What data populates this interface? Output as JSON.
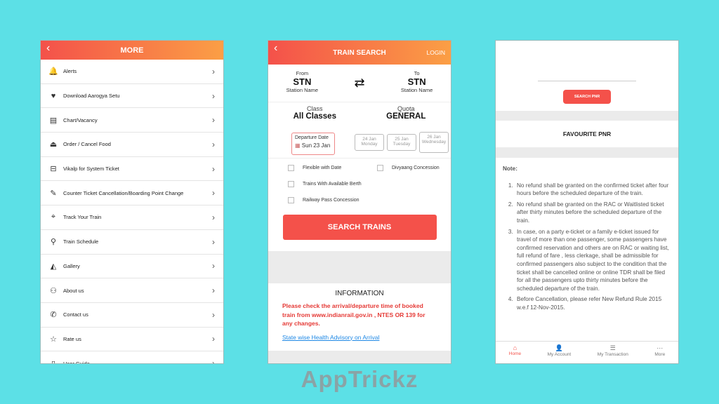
{
  "more": {
    "title": "MORE",
    "items": [
      {
        "label": "Alerts",
        "icon": "bell-icon",
        "glyph": "🔔"
      },
      {
        "label": "Download Aarogya Setu",
        "icon": "heart-icon",
        "glyph": "♥"
      },
      {
        "label": "Chart/Vacancy",
        "icon": "chart-icon",
        "glyph": "▤"
      },
      {
        "label": "Order / Cancel Food",
        "icon": "food-cloche-icon",
        "glyph": "⏏"
      },
      {
        "label": "Vikalp for System Ticket",
        "icon": "train-icon",
        "glyph": "⊟"
      },
      {
        "label": "Counter Ticket Cancellation/Boarding Point Change",
        "icon": "document-edit-icon",
        "glyph": "✎"
      },
      {
        "label": "Track Your Train",
        "icon": "location-pin-icon",
        "glyph": "⌖"
      },
      {
        "label": "Train Schedule",
        "icon": "schedule-icon",
        "glyph": "⚲"
      },
      {
        "label": "Gallery",
        "icon": "gallery-icon",
        "glyph": "◭"
      },
      {
        "label": "About us",
        "icon": "users-icon",
        "glyph": "⚇"
      },
      {
        "label": "Contact us",
        "icon": "phone-icon",
        "glyph": "✆"
      },
      {
        "label": "Rate us",
        "icon": "star-icon",
        "glyph": "☆"
      },
      {
        "label": "User Guide",
        "icon": "guide-icon",
        "glyph": "▯"
      }
    ]
  },
  "search": {
    "title": "TRAIN SEARCH",
    "login": "LOGIN",
    "from": {
      "label": "From",
      "code": "STN",
      "name": "Station Name"
    },
    "to": {
      "label": "To",
      "code": "STN",
      "name": "Station Name"
    },
    "class": {
      "label": "Class",
      "value": "All Classes"
    },
    "quota": {
      "label": "Quota",
      "value": "GENERAL"
    },
    "departure": {
      "label": "Departure Date",
      "value": "Sun 23 Jan"
    },
    "dates": [
      {
        "date": "24 Jan",
        "day": "Monday"
      },
      {
        "date": "25 Jan",
        "day": "Tuesday"
      },
      {
        "date": "26 Jan",
        "day": "Wednesday"
      }
    ],
    "options": [
      "Flexible with Date",
      "Divyaang Concession",
      "Trains With Available Berth",
      "Railway Pass Concession"
    ],
    "button": "SEARCH TRAINS",
    "info_title": "INFORMATION",
    "info_text": "Please check the arrival/departure time of booked train from www.indianrail.gov.in , NTES OR 139 for any changes.",
    "link": "State wise Health Advisory on Arrival"
  },
  "pnr": {
    "button": "SEARCH PNR",
    "favourite": "FAVOURITE PNR",
    "note_title": "Note:",
    "notes": [
      "No refund shall be granted on the confirmed ticket after four hours before the scheduled departure of the train.",
      "No refund shall be granted on the RAC or Waitlisted ticket after thirty minutes before the scheduled departure of the train.",
      "In case, on a party e-ticket or a family e-ticket issued for travel of more than one passenger, some passengers have confirmed reservation and others are on RAC or waiting list, full refund of fare , less clerkage, shall be admissible for confirmed passengers also subject to the condition that the ticket shall be cancelled online or online TDR shall be filed for all the passengers upto thirty minutes before the scheduled departure of the train.",
      "Before Cancellation, please refer New Refund Rule 2015 w.e.f 12-Nov-2015."
    ],
    "nav": [
      {
        "label": "Home",
        "icon": "home-icon",
        "glyph": "⌂"
      },
      {
        "label": "My Account",
        "icon": "person-icon",
        "glyph": "👤"
      },
      {
        "label": "My Transaction",
        "icon": "list-icon",
        "glyph": "☰"
      },
      {
        "label": "More",
        "icon": "more-dots-icon",
        "glyph": "⋯"
      }
    ],
    "active_color": "#f4514a"
  },
  "watermark": "AppTrickz"
}
